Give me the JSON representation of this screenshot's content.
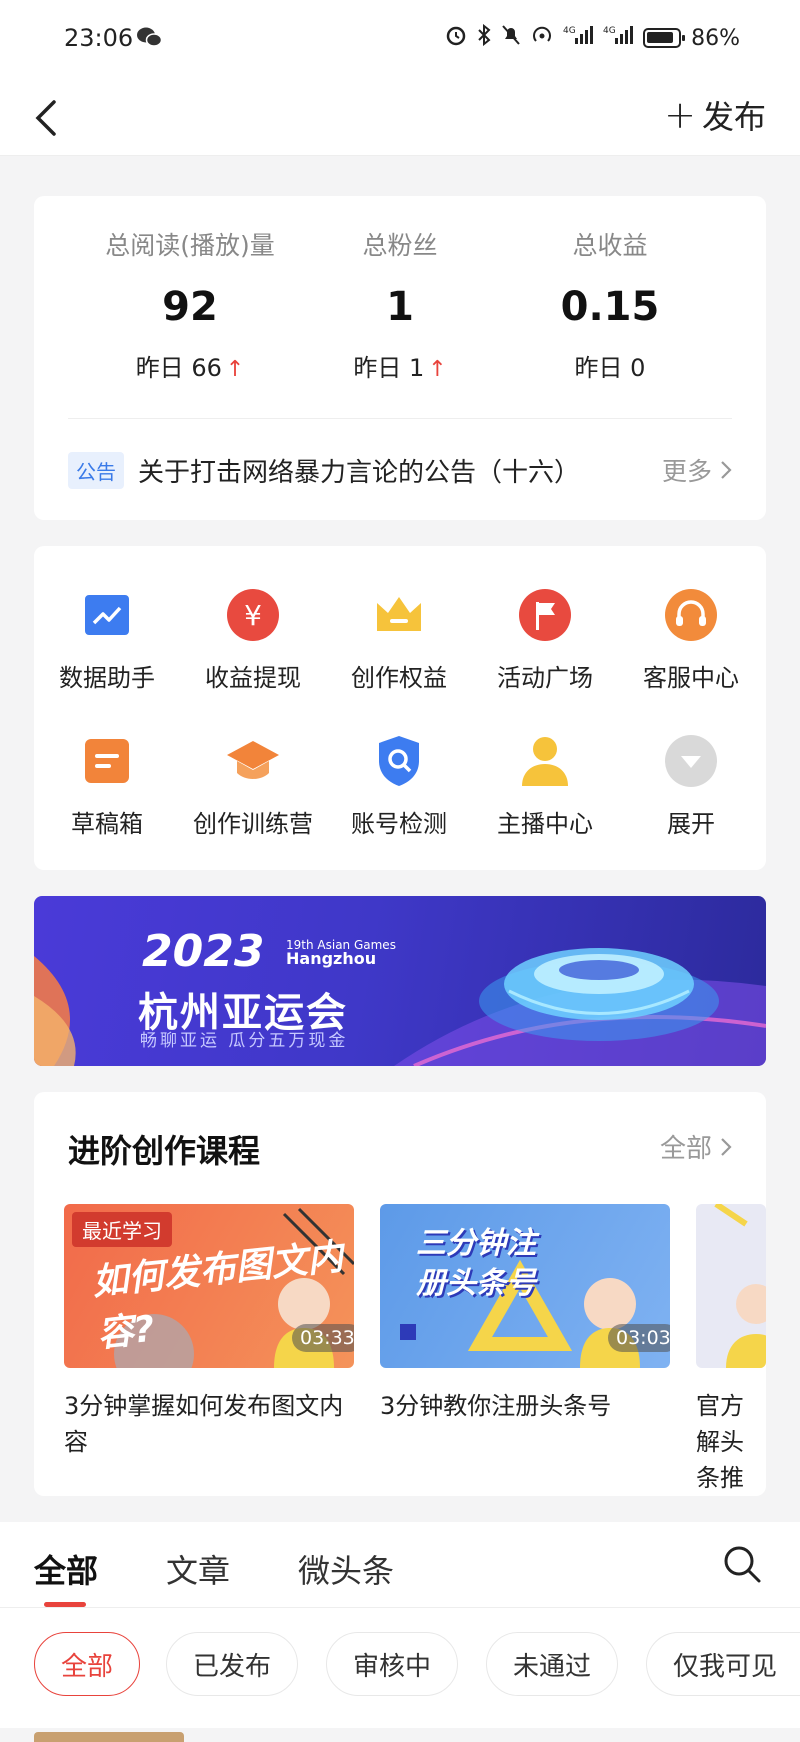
{
  "status_bar": {
    "time": "23:06",
    "battery": "86%",
    "net1": "4G",
    "net2": "4G"
  },
  "nav": {
    "publish_label": "发布"
  },
  "stats": {
    "items": [
      {
        "label": "总阅读(播放)量",
        "value": "92",
        "yesterday": "昨日 66",
        "trend": "up"
      },
      {
        "label": "总粉丝",
        "value": "1",
        "yesterday": "昨日 1",
        "trend": "up"
      },
      {
        "label": "总收益",
        "value": "0.15",
        "yesterday": "昨日 0",
        "trend": "none"
      }
    ],
    "notice": {
      "badge": "公告",
      "text": "关于打击网络暴力言论的公告（十六）",
      "more": "更多"
    }
  },
  "tools": {
    "items": [
      {
        "label": "数据助手",
        "icon": "chart-icon"
      },
      {
        "label": "收益提现",
        "icon": "yuan-icon"
      },
      {
        "label": "创作权益",
        "icon": "crown-icon"
      },
      {
        "label": "活动广场",
        "icon": "flag-icon"
      },
      {
        "label": "客服中心",
        "icon": "headset-icon"
      },
      {
        "label": "草稿箱",
        "icon": "draft-icon"
      },
      {
        "label": "创作训练营",
        "icon": "graduation-cap-icon"
      },
      {
        "label": "账号检测",
        "icon": "shield-search-icon"
      },
      {
        "label": "主播中心",
        "icon": "person-icon"
      },
      {
        "label": "展开",
        "icon": "expand-icon"
      }
    ]
  },
  "banner": {
    "year": "2023",
    "city": "杭州亚运会",
    "slogan": "畅聊亚运 瓜分五万现金",
    "games_small": "19th Asian Games",
    "games_name": "Hangzhou"
  },
  "courses": {
    "title": "进阶创作课程",
    "all_label": "全部",
    "items": [
      {
        "tag": "最近学习",
        "duration": "03:33",
        "thumb_text": "如何发布图文内容?",
        "title": "3分钟掌握如何发布图文内容"
      },
      {
        "tag": "",
        "duration": "03:03",
        "thumb_text": "三分钟注册头条号",
        "title": "3分钟教你注册头条号"
      },
      {
        "tag": "",
        "duration": "",
        "thumb_text": "",
        "title": "官方解头条推"
      }
    ]
  },
  "tabs": {
    "items": [
      "全部",
      "文章",
      "微头条"
    ],
    "active": 0
  },
  "filters": {
    "items": [
      "全部",
      "已发布",
      "审核中",
      "未通过",
      "仅我可见"
    ],
    "active": 0
  },
  "colors": {
    "accent": "#e8433c",
    "muted": "#999999",
    "notice_blue": "#3a7ae8"
  }
}
